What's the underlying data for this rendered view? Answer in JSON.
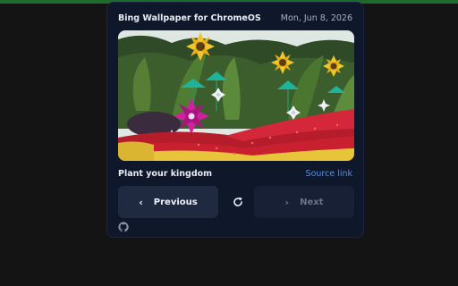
{
  "header": {
    "app_title": "Bing Wallpaper for ChromeOS",
    "date": "Mon, Jun 8, 2026"
  },
  "photo": {
    "subject": "garden with pinwheels and sunflowers"
  },
  "caption": {
    "title": "Plant your kingdom",
    "source_label": "Source link"
  },
  "controls": {
    "previous_label": "Previous",
    "next_label": "Next",
    "previous_icon": "chevron-left-icon",
    "next_icon": "chevron-right-icon",
    "refresh_icon": "refresh-icon"
  },
  "footer": {
    "github_icon": "github-icon"
  },
  "colors": {
    "background": "#141414",
    "panel": "#0f172b",
    "accent_link": "#5b8fd9",
    "top_strip": "#1f6b2e"
  }
}
